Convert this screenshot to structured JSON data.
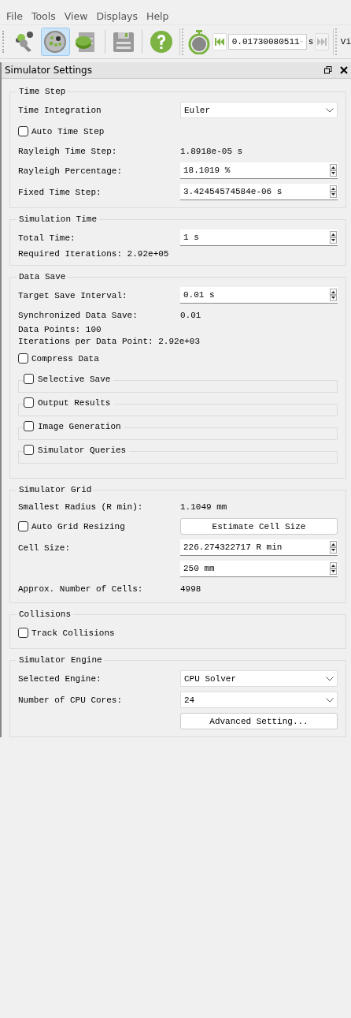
{
  "menu": [
    "File",
    "Tools",
    "View",
    "Displays",
    "Help"
  ],
  "toolbar": {
    "tools": [
      {
        "kind": "wrench",
        "selected": false
      },
      {
        "kind": "particles",
        "selected": true
      },
      {
        "kind": "chart",
        "selected": false
      },
      {
        "kind": "save",
        "selected": false
      },
      {
        "kind": "help",
        "selected": false
      }
    ],
    "time_value": "0.01730080511",
    "time_unit": "s",
    "cut_label": "Vi"
  },
  "dock": {
    "title": "Simulator Settings"
  },
  "sections": [
    {
      "title": "Time Step",
      "rows": [
        {
          "kind": "combo",
          "label": "Time Integration",
          "value": "Euler"
        },
        {
          "kind": "checkbox",
          "label": "Auto Time Step",
          "checked": false
        },
        {
          "kind": "readout",
          "label": "Rayleigh Time Step:",
          "value": "1.8918e-05 s"
        },
        {
          "kind": "spin",
          "label": "Rayleigh Percentage:",
          "value": "18.1019 %"
        },
        {
          "kind": "spin",
          "label": "Fixed Time Step:",
          "value": "3.42454574584e-06 s"
        }
      ]
    },
    {
      "title": "Simulation Time",
      "rows": [
        {
          "kind": "spin",
          "label": "Total Time:",
          "value": "1 s"
        },
        {
          "kind": "text",
          "label": "Required Iterations: 2.92e+05"
        }
      ]
    },
    {
      "title": "Data Save",
      "rows": [
        {
          "kind": "spin",
          "label": "Target Save Interval:",
          "value": "0.01 s"
        },
        {
          "kind": "readout",
          "label": "Synchronized Data Save:",
          "value": "0.01"
        },
        {
          "kind": "text",
          "label": "Data Points: 100"
        },
        {
          "kind": "text",
          "label": "Iterations per Data Point: 2.92e+03"
        },
        {
          "kind": "checkbox",
          "label": "Compress Data",
          "checked": false
        },
        {
          "kind": "subgroup",
          "label": "Selective Save",
          "checked": false
        },
        {
          "kind": "subgroup",
          "label": "Output Results",
          "checked": false
        },
        {
          "kind": "subgroup",
          "label": "Image Generation",
          "checked": false
        },
        {
          "kind": "subgroup",
          "label": "Simulator Queries",
          "checked": false
        }
      ]
    },
    {
      "title": "Simulator Grid",
      "rows": [
        {
          "kind": "readout",
          "label": "Smallest Radius (R min):",
          "value": "1.1049 mm"
        },
        {
          "kind": "checkbutton",
          "label": "Auto Grid Resizing",
          "checked": false,
          "button": "Estimate Cell Size"
        },
        {
          "kind": "spin",
          "label": "Cell Size:",
          "value": "226.274322717 R min"
        },
        {
          "kind": "spin",
          "value": "250 mm"
        },
        {
          "kind": "readout",
          "label": "Approx. Number of Cells:",
          "value": "4998"
        }
      ]
    },
    {
      "title": "Collisions",
      "rows": [
        {
          "kind": "checkbox",
          "label": "Track Collisions",
          "checked": false
        }
      ]
    },
    {
      "title": "Simulator Engine",
      "rows": [
        {
          "kind": "combo",
          "label": "Selected Engine:",
          "value": "CPU Solver"
        },
        {
          "kind": "combo",
          "label": "Number of CPU Cores:",
          "value": "24"
        },
        {
          "kind": "button",
          "button": "Advanced Setting..."
        }
      ]
    }
  ]
}
